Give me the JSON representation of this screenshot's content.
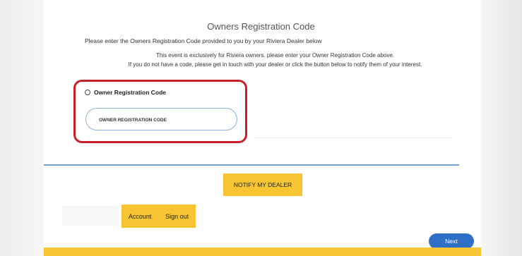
{
  "page": {
    "title": "Owners Registration Code",
    "instruction": "Please enter the Owners Registration Code provided to you by your Riviera Dealer below",
    "notice_line1": "This event is exclusively for Riviera owners. please enter your Owner Registration Code above.",
    "notice_line2": "If you do not have a code, please get in touch with your dealer or click the button below to notify them of your interest."
  },
  "form": {
    "radio_label": "Owner Registration Code",
    "code_input": {
      "value": "",
      "placeholder": "OWNER REGISTRATION CODE"
    },
    "highlight_color": "#c8202a"
  },
  "actions": {
    "notify_label": "NOTIFY MY DEALER",
    "account_label": "Account",
    "signout_label": "Sign out",
    "next_label": "Next"
  },
  "colors": {
    "accent_yellow": "#f7c531",
    "primary_blue": "#2f6fc6",
    "divider_blue": "#6fa4d6"
  }
}
